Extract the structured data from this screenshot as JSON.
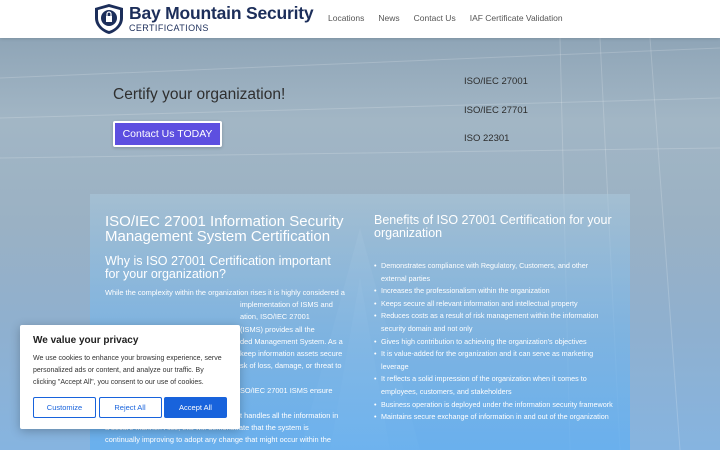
{
  "header": {
    "logo_title": "Bay Mountain Security",
    "logo_subtitle": "CERTIFICATIONS",
    "nav": [
      "Locations",
      "News",
      "Contact Us",
      "IAF Certificate Validation"
    ]
  },
  "hero": {
    "tagline": "Certify your organization!",
    "cta_label": "Contact Us TODAY",
    "standards": [
      "ISO/IEC 27001",
      "ISO/IEC 27701",
      "ISO 22301"
    ]
  },
  "content": {
    "left_title": "ISO/IEC 27001 Information Security Management System Certification",
    "left_subtitle": "Why is ISO 27001 Certification important for your organization?",
    "left_para_1_lines": [
      "While the complexity within the organization rises it is highly considered a",
      "implementation of ISMS and",
      "(ISMS) provides all the",
      "ded Management System. As a",
      "keep information assets secure",
      "sk of loss, damage, or threat to"
    ],
    "left_para_2_lines": [
      "SO/IEC 27001 ISMS ensure that",
      "t handles all the information in",
      "a secure manner. Also, this will demonstrate that the system is",
      "continually improving to adopt any change that might occur within the"
    ],
    "left_para_1_extra": "ation, ISO/IEC 27001",
    "right_title": "Benefits of ISO 27001 Certification for your organization",
    "benefits": [
      "Demonstrates compliance with Regulatory, Customers, and other external parties",
      "Increases the professionalism within the organization",
      "Keeps secure all relevant information and intellectual property",
      "Reduces costs as a result of risk management within the information security domain and not only",
      "Gives high contribution to achieving the organization's objectives",
      "It is value-added for the organization and it can serve as marketing leverage",
      "It reflects a solid impression of the organization when it comes to employees, customers, and stakeholders",
      "Business operation is deployed under the information security framework",
      "Maintains secure exchange of information in and out of the organization"
    ]
  },
  "cookie": {
    "title": "We value your privacy",
    "body": "We use cookies to enhance your browsing experience, serve personalized ads or content, and analyze our traffic. By clicking \"Accept All\", you consent to our use of cookies.",
    "customize": "Customize",
    "reject": "Reject All",
    "accept": "Accept All"
  },
  "colors": {
    "brand_navy": "#1c2e5a",
    "cta_purple": "#5d4fe0",
    "cookie_blue": "#1863dc"
  }
}
